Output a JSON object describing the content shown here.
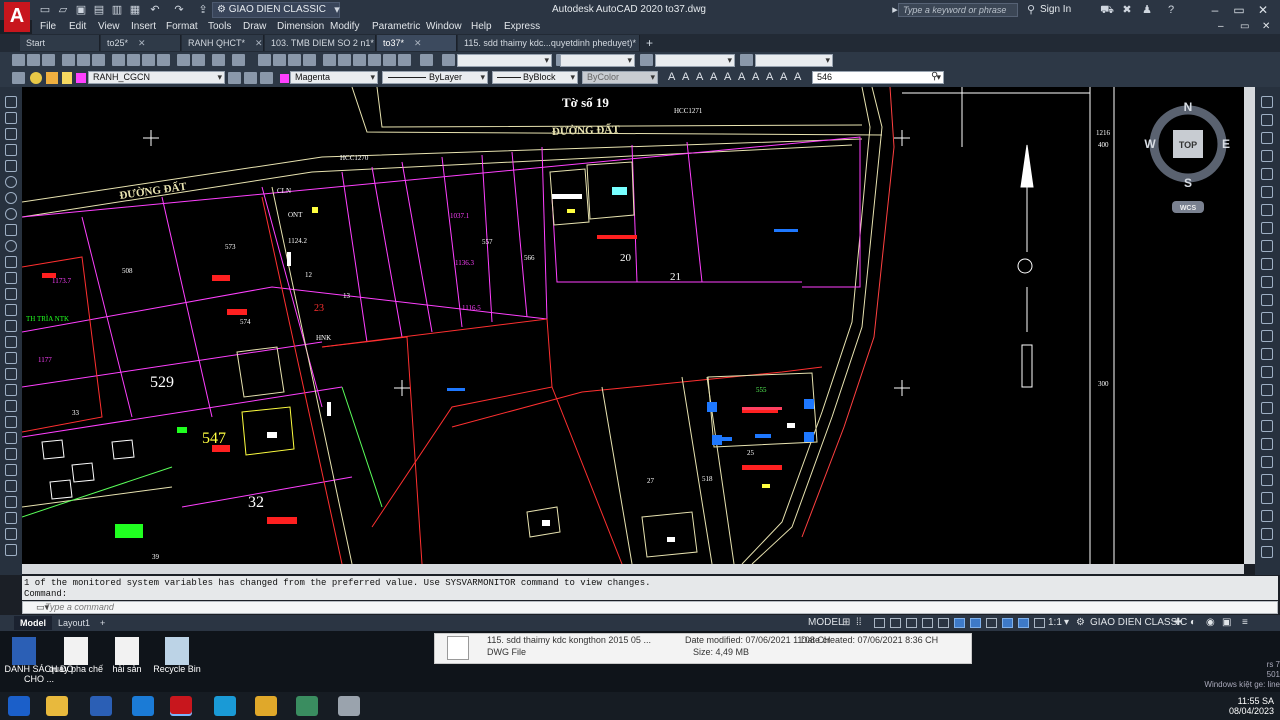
{
  "titlebar": {
    "app_letter": "A",
    "workspace": "GIAO DIEN CLASSIC",
    "title": "Autodesk AutoCAD 2020    to37.dwg",
    "search_placeholder": "Type a keyword or phrase",
    "sign_in": "Sign In"
  },
  "menu": [
    "File",
    "Edit",
    "View",
    "Insert",
    "Format",
    "Tools",
    "Draw",
    "Dimension",
    "Modify",
    "Parametric",
    "Window",
    "Help",
    "Express"
  ],
  "tabs": [
    {
      "label": "Start",
      "active": false
    },
    {
      "label": "to25*",
      "active": false
    },
    {
      "label": "RANH QHCT*",
      "active": false
    },
    {
      "label": "103. TMB DIEM SO 2 n1*",
      "active": false
    },
    {
      "label": "to37*",
      "active": true
    },
    {
      "label": "115. sdd thaimy kdc...quyetdinh pheduyet)*",
      "active": false
    }
  ],
  "properties": {
    "layer": "RANH_CGCN",
    "color": "Magenta",
    "linetype": "ByLayer",
    "lineweight": "ByBlock",
    "plotstyle": "ByColor",
    "text_value": "546"
  },
  "drawing": {
    "labels": {
      "sheet": "Tờ số 19",
      "road_top": "ĐƯỜNG ĐẤT",
      "road_left": "ĐƯỜNG ĐẤT",
      "hcc1271": "HCC1271",
      "hcc1270": "HCC1270",
      "p573": "573",
      "p508": "508",
      "p574": "574",
      "p529": "529",
      "p547": "547",
      "p32": "32",
      "p33": "33",
      "p20": "20",
      "p21": "21",
      "p557": "557",
      "p566": "566",
      "p555": "555",
      "p25": "25",
      "p27": "27",
      "p518": "518",
      "p13": "13",
      "p12": "12",
      "p23": "23",
      "p39": "39",
      "ont": "ONT",
      "cln": "CLN",
      "hnk": "HNK",
      "p1242": "1124.2",
      "p1037": "1037.1",
      "p1163": "1136.3",
      "p1165": "1116.5",
      "p1177": "1177",
      "p1173": "1173.7",
      "thtria": "TH TRÌA NTK",
      "p1216": "1216",
      "p400": "400",
      "p300": "300"
    },
    "viewcube": {
      "n": "N",
      "s": "S",
      "e": "E",
      "w": "W",
      "top": "TOP",
      "wcs": "WCS"
    }
  },
  "command": {
    "history_line1": "1 of the monitored system variables has changed from the preferred value. Use SYSVARMONITOR command to view changes.",
    "history_line2": "Command:",
    "placeholder": "Type  a  command"
  },
  "status": {
    "model_tab": "Model",
    "layout_tab": "Layout1",
    "add_tab": "+",
    "model_space": "MODEL",
    "scale": "1:1",
    "workspace": "GIAO DIEN CLASSIC"
  },
  "desktop": {
    "icons": [
      "DANH SÁCH ĐỒ CHO ...",
      "quay pha chế",
      "hải sản",
      "Recycle Bin"
    ],
    "file_tip": {
      "name": "115. sdd thaimy kdc kongthon 2015 05 ...",
      "modified": "Date modified: 07/06/2021 11:08 CH",
      "created": "Date created: 07/06/2021 8:36 CH",
      "type": "DWG File",
      "size": "Size: 4,49 MB"
    },
    "corner": [
      "rs 7",
      "501",
      "Windows kíệt ge: line"
    ]
  },
  "taskbar": {
    "time": "11:55 SA",
    "date": "08/04/2023"
  },
  "colors": {
    "titlebar": "#2b3543",
    "canvas": "#000000",
    "accent": "#c8161d",
    "magenta": "#ff40ff",
    "red": "#ff2020",
    "yellow": "#ffff40",
    "blue": "#1e78ff"
  }
}
